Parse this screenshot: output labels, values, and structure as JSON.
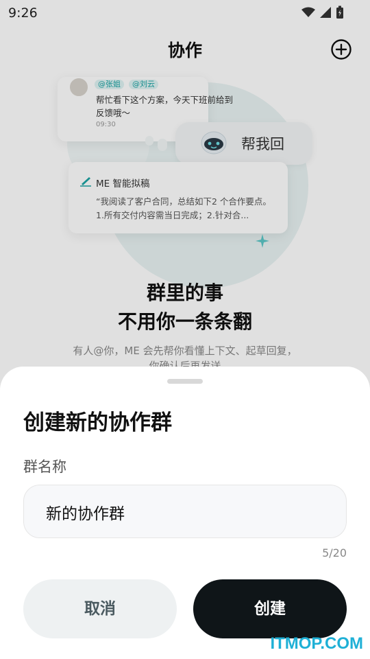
{
  "status_bar": {
    "time": "9:26"
  },
  "header": {
    "title": "协作",
    "add_icon": "plus-circle-icon"
  },
  "illustration": {
    "message": {
      "tag_a": "@张姐",
      "tag_b": "@刘云",
      "text": "帮忙看下这个方案，今天下班前给到反馈哦～",
      "time": "09:30"
    },
    "reply_bubble": {
      "label": "帮我回"
    },
    "ai_card": {
      "title": "ME 智能拟稿",
      "body": "“我阅读了客户合同，总结如下2 个合作要点。1.所有交付内容需当日完成；2.针对合..."
    }
  },
  "promo": {
    "title_line1": "群里的事",
    "title_line2": "不用你一条条翻",
    "desc": "有人@你，ME 会先帮你看懂上下文、起草回复，你确认后再发送"
  },
  "sheet": {
    "title": "创建新的协作群",
    "field_label": "群名称",
    "input_value": "新的协作群",
    "char_count": "5/20",
    "cancel_label": "取消",
    "create_label": "创建"
  },
  "watermark": "ITMOP.COM",
  "colors": {
    "accent": "#1ba3a3",
    "primary_button": "#0f1518",
    "secondary_button": "#eef1f2"
  }
}
